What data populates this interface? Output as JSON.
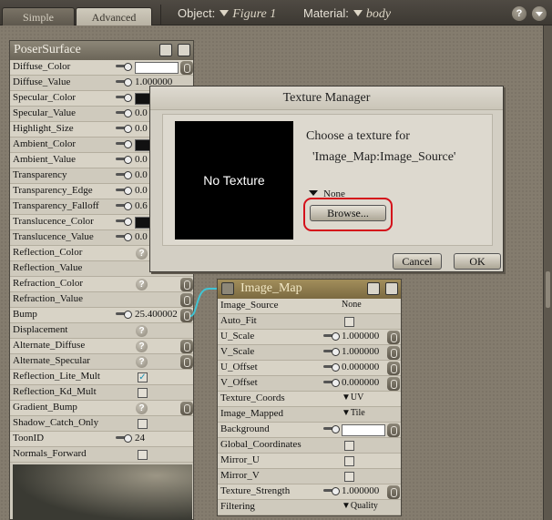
{
  "tabs": [
    {
      "label": "Simple"
    },
    {
      "label": "Advanced"
    }
  ],
  "object": {
    "label": "Object:",
    "value": "Figure 1"
  },
  "material": {
    "label": "Material:",
    "value": "body"
  },
  "help_glyph": "?",
  "poser_surface": {
    "title": "PoserSurface",
    "diffuse_value": "1.000000",
    "bump_value": "25.400002",
    "toon_id": "24",
    "rows": [
      {
        "name": "Diffuse_Color"
      },
      {
        "name": "Diffuse_Value"
      },
      {
        "name": "Specular_Color"
      },
      {
        "name": "Specular_Value"
      },
      {
        "name": "Highlight_Size"
      },
      {
        "name": "Ambient_Color"
      },
      {
        "name": "Ambient_Value"
      },
      {
        "name": "Transparency"
      },
      {
        "name": "Transparency_Edge"
      },
      {
        "name": "Transparency_Falloff"
      },
      {
        "name": "Translucence_Color"
      },
      {
        "name": "Translucence_Value"
      },
      {
        "name": "Reflection_Color"
      },
      {
        "name": "Reflection_Value"
      },
      {
        "name": "Refraction_Color"
      },
      {
        "name": "Refraction_Value"
      },
      {
        "name": "Bump"
      },
      {
        "name": "Displacement"
      },
      {
        "name": "Alternate_Diffuse"
      },
      {
        "name": "Alternate_Specular"
      },
      {
        "name": "Reflection_Lite_Mult"
      },
      {
        "name": "Reflection_Kd_Mult"
      },
      {
        "name": "Gradient_Bump"
      },
      {
        "name": "Shadow_Catch_Only"
      },
      {
        "name": "ToonID"
      },
      {
        "name": "Normals_Forward"
      }
    ],
    "partial_values": {
      "v2": "0.0",
      "v3": "0.0",
      "v4": "0.0",
      "v5": "0.0",
      "v6": "0.0",
      "v7": "0.6",
      "v8": "0.0"
    },
    "reflection_lite_mult_checked": true
  },
  "image_map": {
    "title": "Image_Map",
    "rows": [
      {
        "name": "Image_Source",
        "value": "None"
      },
      {
        "name": "Auto_Fit"
      },
      {
        "name": "U_Scale",
        "value": "1.000000"
      },
      {
        "name": "V_Scale",
        "value": "1.000000"
      },
      {
        "name": "U_Offset",
        "value": "0.000000"
      },
      {
        "name": "V_Offset",
        "value": "0.000000"
      },
      {
        "name": "Texture_Coords",
        "value": "UV"
      },
      {
        "name": "Image_Mapped",
        "value": "Tile"
      },
      {
        "name": "Background"
      },
      {
        "name": "Global_Coordinates"
      },
      {
        "name": "Mirror_U"
      },
      {
        "name": "Mirror_V"
      },
      {
        "name": "Texture_Strength",
        "value": "1.000000"
      },
      {
        "name": "Filtering",
        "value": "Quality"
      }
    ]
  },
  "texture_manager": {
    "title": "Texture Manager",
    "preview_text": "No Texture",
    "prompt": "Choose a texture for",
    "target": "'Image_Map:Image_Source'",
    "selection": "None",
    "browse_label": "Browse...",
    "cancel_label": "Cancel",
    "ok_label": "OK"
  },
  "colors": {
    "highlight": "#d4101a",
    "node_header": "#8d8778",
    "image_map_header": "#a28e5b",
    "cable": "#40c4d4"
  }
}
